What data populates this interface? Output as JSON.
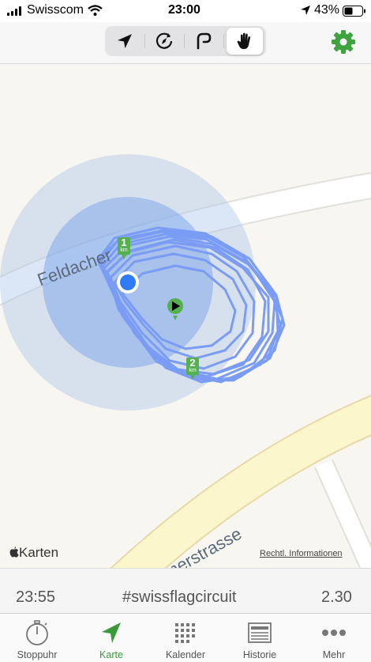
{
  "status": {
    "carrier": "Swisscom",
    "time": "23:00",
    "battery": "43%"
  },
  "toolbar": {
    "modes": [
      {
        "icon": "location-arrow-icon"
      },
      {
        "icon": "compass-rotate-icon"
      },
      {
        "icon": "route-shape-icon"
      },
      {
        "icon": "hand-icon",
        "selected": true
      }
    ],
    "settings_icon": "gear-icon",
    "accent": "#3fa33f"
  },
  "map": {
    "streets": [
      "Feldacher",
      "eimerstrasse"
    ],
    "km_markers": [
      {
        "num": "1",
        "unit": "km"
      },
      {
        "num": "2",
        "unit": "km"
      }
    ],
    "attribution": "Karten",
    "legal": "Rechtl. Informationen",
    "colors": {
      "route": "#7b9cf5",
      "accuracy": "#aac4ea",
      "position": "#2f7bf5",
      "marker": "#55b04f",
      "road_major": "#fbf6cc"
    }
  },
  "info": {
    "left": "23:55",
    "center": "#swissflagcircuit",
    "right": "2.30"
  },
  "tabs": [
    {
      "label": "Stoppuhr",
      "icon": "stopwatch-icon"
    },
    {
      "label": "Karte",
      "icon": "navigation-arrow-icon",
      "active": true
    },
    {
      "label": "Kalender",
      "icon": "calendar-grid-icon"
    },
    {
      "label": "Historie",
      "icon": "history-list-icon"
    },
    {
      "label": "Mehr",
      "icon": "more-dots-icon"
    }
  ]
}
